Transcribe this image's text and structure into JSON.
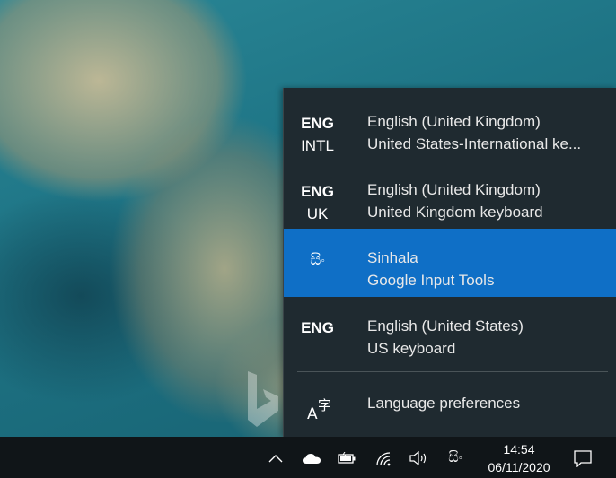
{
  "flyout": {
    "items": [
      {
        "abbr_top": "ENG",
        "abbr_bottom": "INTL",
        "language": "English (United Kingdom)",
        "keyboard": "United States-International ke..."
      },
      {
        "abbr_top": "ENG",
        "abbr_bottom": "UK",
        "language": "English (United Kingdom)",
        "keyboard": "United Kingdom keyboard"
      },
      {
        "abbr_top": "සිං",
        "abbr_bottom": "",
        "language": "Sinhala",
        "keyboard": "Google Input Tools",
        "selected": true
      },
      {
        "abbr_top": "ENG",
        "abbr_bottom": "",
        "language": "English (United States)",
        "keyboard": "US keyboard"
      }
    ],
    "preferences_label": "Language preferences",
    "preferences_icon": "language-settings-icon"
  },
  "taskbar": {
    "tray_icons": [
      "chevron-up-icon",
      "onedrive-cloud-icon",
      "battery-icon",
      "wifi-icon",
      "volume-icon",
      "input-indicator-icon"
    ],
    "input_indicator": "සිං",
    "time": "14:54",
    "date": "06/11/2020",
    "notification_icon": "action-center-icon"
  },
  "colors": {
    "flyout_bg": "#1f2a30",
    "selected_bg": "#0f6fc6",
    "taskbar_bg": "#101518"
  }
}
